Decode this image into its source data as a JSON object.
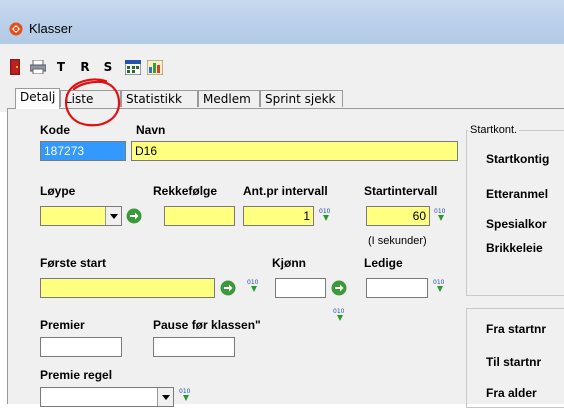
{
  "window": {
    "title": "Klasser"
  },
  "toolbar": {
    "letters": [
      "T",
      "R",
      "S"
    ],
    "icons": [
      "exit-door-icon",
      "print-icon",
      "calendar-icon",
      "chart-icon"
    ]
  },
  "tabs": [
    {
      "label": "Detalj"
    },
    {
      "label": "Liste"
    },
    {
      "label": "Statistikk"
    },
    {
      "label": "Medlem"
    },
    {
      "label": "Sprint sjekk"
    }
  ],
  "form": {
    "kode": {
      "label": "Kode",
      "value": "187273"
    },
    "navn": {
      "label": "Navn",
      "value": "D16"
    },
    "loype": {
      "label": "Løype",
      "value": ""
    },
    "rekkefolge": {
      "label": "Rekkefølge",
      "value": ""
    },
    "ant_pr_intervall": {
      "label": "Ant.pr intervall",
      "value": "1"
    },
    "startintervall": {
      "label": "Startintervall",
      "value": "60",
      "note": "(I sekunder)"
    },
    "forste_start": {
      "label": "Første start",
      "value": ""
    },
    "kjonn": {
      "label": "Kjønn",
      "value": ""
    },
    "ledige": {
      "label": "Ledige",
      "value": ""
    },
    "premier": {
      "label": "Premier",
      "value": ""
    },
    "pause": {
      "label": "Pause før klassen\"",
      "value": ""
    },
    "premie_regel": {
      "label": "Premie regel",
      "value": ""
    }
  },
  "startkont": {
    "title": "Startkont.",
    "items": [
      "Startkontig",
      "Etteranmel",
      "Spesialkor",
      "Brikkeleie"
    ]
  },
  "range": {
    "items": [
      "Fra startnr",
      "Til startnr",
      "Fra alder"
    ]
  },
  "colors": {
    "field_yellow": "#ffff80",
    "selection": "#3399ff",
    "annotation": "#e01010"
  }
}
